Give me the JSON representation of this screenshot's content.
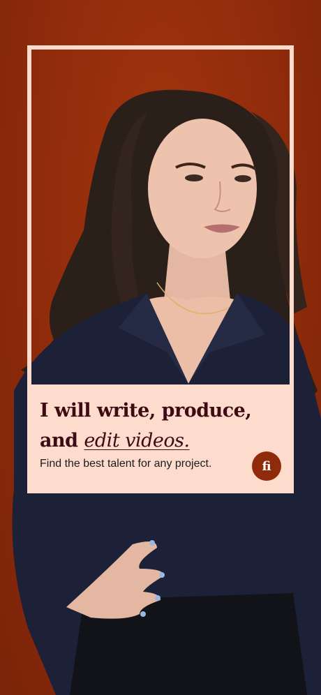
{
  "hero": {
    "headline_line1": "I will write, produce,",
    "headline_and": "and",
    "headline_emphasis": "edit videos.",
    "subline": "Find the best talent for any project.",
    "logo_text": "fi"
  },
  "colors": {
    "background": "#982f0d",
    "card": "#fddccd",
    "headline": "#3e0a14",
    "logo": "#8f2b0b"
  }
}
